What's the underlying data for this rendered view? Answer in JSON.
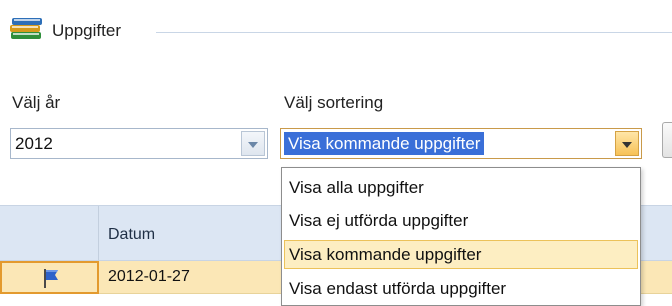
{
  "header": {
    "title": "Uppgifter",
    "icon": "books-icon"
  },
  "filters": {
    "year_label": "Välj år",
    "year_value": "2012",
    "sort_label": "Välj sortering",
    "sort_value": "Visa kommande uppgifter"
  },
  "dropdown": {
    "options": [
      "Visa alla uppgifter",
      "Visa ej utförda uppgifter",
      "Visa kommande uppgifter",
      "Visa endast utförda uppgifter"
    ],
    "highlighted_index": 2
  },
  "grid": {
    "columns": [
      "",
      "Datum"
    ],
    "rows": [
      {
        "flag_icon": "blue-flag-icon",
        "datum": "2012-01-27"
      }
    ]
  },
  "colors": {
    "selection_blue": "#3a6fd8",
    "highlight_amber": "#fdeec2",
    "row_selected": "#fbe7b6",
    "header_blue": "#dce6f3"
  }
}
